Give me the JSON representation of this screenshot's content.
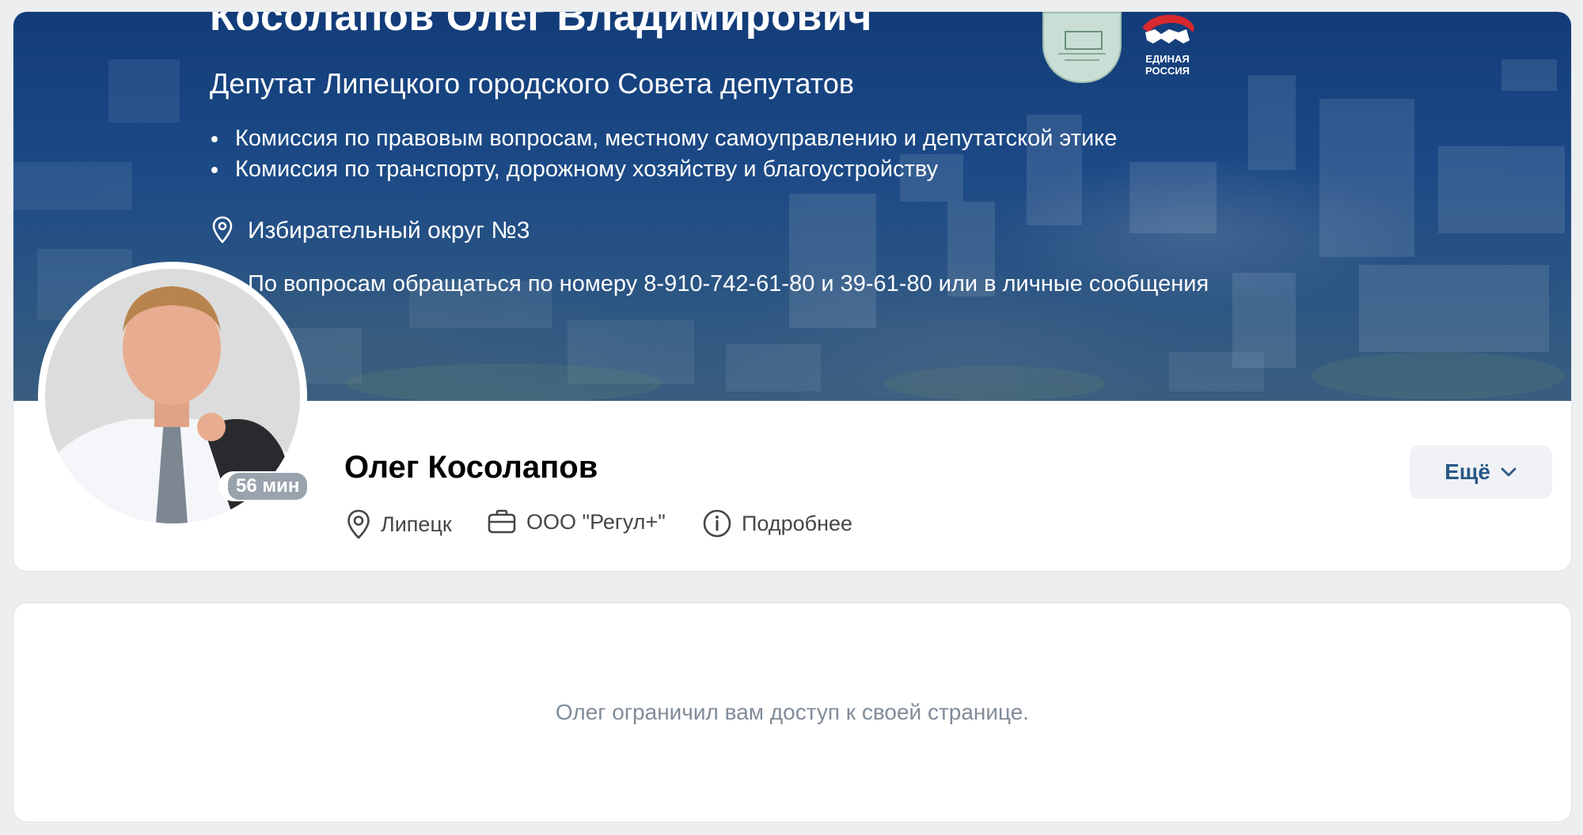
{
  "cover": {
    "name": "Косолапов Олег Владимирович",
    "subtitle": "Депутат Липецкого городского Совета депутатов",
    "bullets": [
      "Комиссия по правовым вопросам, местному самоуправлению и депутатской этике",
      "Комиссия по транспорту, дорожному хозяйству и благоустройству"
    ],
    "district": "Избирательный округ  №3",
    "contact": "По вопросам обращаться по номеру 8-910-742-61-80 и 39-61-80 или в личные сообщения",
    "party_logo_text": [
      "ЕДИНАЯ",
      "РОССИЯ"
    ]
  },
  "profile": {
    "name": "Олег Косолапов",
    "online_status": "56 мин",
    "city": "Липецк",
    "work": "ООО \"Регул+\"",
    "more_info": "Подробнее",
    "more_button": "Ещё"
  },
  "restricted": {
    "message": "Олег ограничил вам доступ к своей странице."
  },
  "colors": {
    "page_bg": "#edeef0",
    "cover_blue": "#1c4a86",
    "link_blue": "#2a5885",
    "badge_gray": "#99a2ad",
    "muted_text": "#818c99"
  },
  "icons": [
    "location-pin-icon",
    "briefcase-icon",
    "info-icon",
    "chevron-down-icon"
  ]
}
